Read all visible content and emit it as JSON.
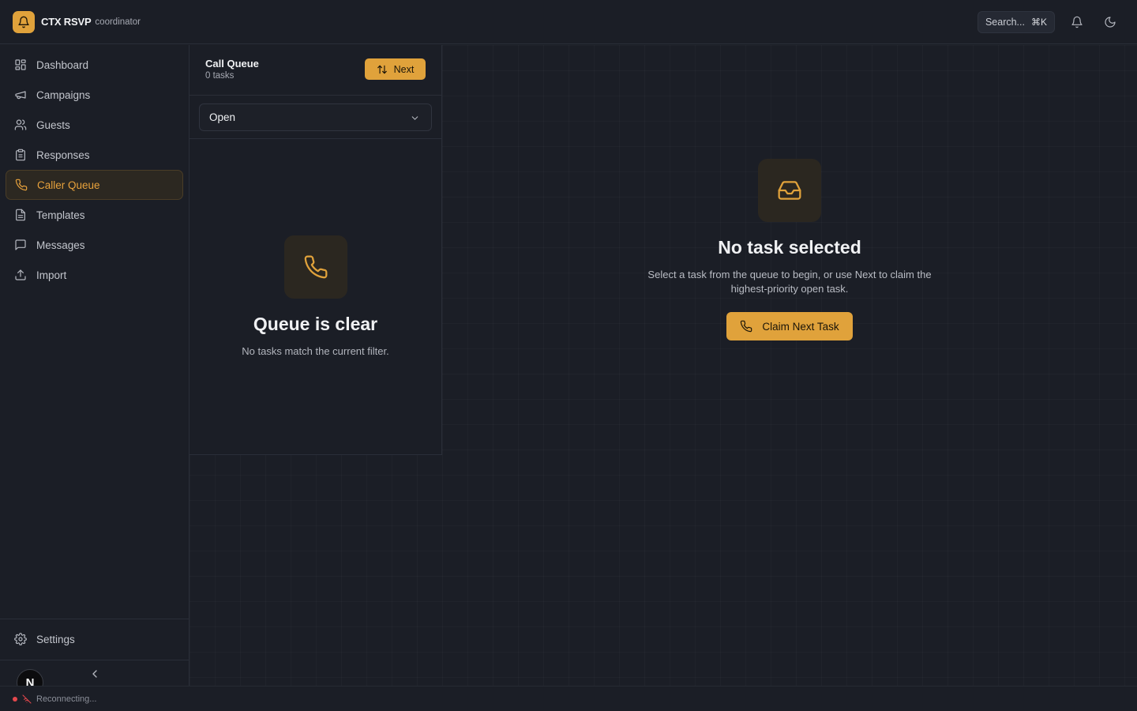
{
  "app": {
    "name": "CTX RSVP",
    "role": "coordinator",
    "logo_icon": "bell-icon",
    "accent_color": "#e0a23b"
  },
  "topbar": {
    "search_label": "Search...",
    "search_shortcut": "⌘K",
    "icons": [
      "bell-icon",
      "moon-icon"
    ]
  },
  "sidebar": {
    "items": [
      {
        "label": "Dashboard",
        "icon": "dashboard-icon",
        "active": false
      },
      {
        "label": "Campaigns",
        "icon": "megaphone-icon",
        "active": false
      },
      {
        "label": "Guests",
        "icon": "users-icon",
        "active": false
      },
      {
        "label": "Responses",
        "icon": "clipboard-icon",
        "active": false
      },
      {
        "label": "Caller Queue",
        "icon": "phone-icon",
        "active": true
      },
      {
        "label": "Templates",
        "icon": "file-text-icon",
        "active": false
      },
      {
        "label": "Messages",
        "icon": "message-icon",
        "active": false
      },
      {
        "label": "Import",
        "icon": "upload-icon",
        "active": false
      }
    ],
    "settings_label": "Settings",
    "avatar_initial": "N"
  },
  "status": {
    "text": "Reconnecting...",
    "color": "#e5484d"
  },
  "queue": {
    "title": "Call Queue",
    "count_text": "0 tasks",
    "next_label": "Next",
    "filter_value": "Open",
    "empty_title": "Queue is clear",
    "empty_subtitle": "No tasks match the current filter."
  },
  "detail": {
    "empty_title": "No task selected",
    "empty_subtitle": "Select a task from the queue to begin, or use Next to claim the highest-priority open task.",
    "claim_label": "Claim Next Task"
  }
}
